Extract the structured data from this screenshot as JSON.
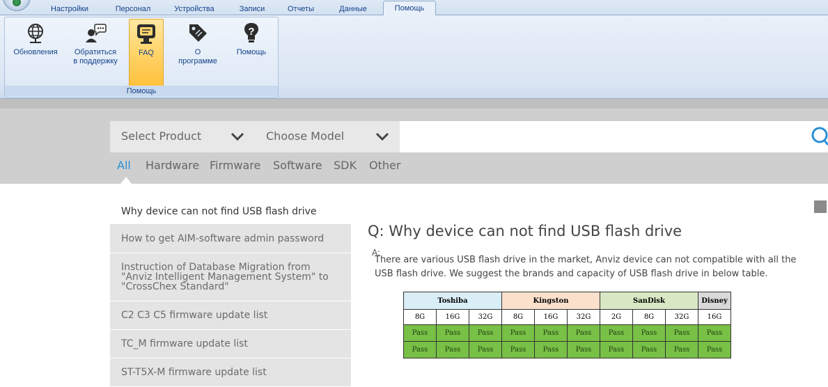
{
  "ribbon": {
    "tabs": [
      {
        "label": "Настройки"
      },
      {
        "label": "Персонал"
      },
      {
        "label": "Устройства"
      },
      {
        "label": "Записи"
      },
      {
        "label": "Отчеты"
      },
      {
        "label": "Данные"
      },
      {
        "label": "Помощь",
        "active": true
      }
    ],
    "group_caption": "Помощь",
    "buttons": [
      {
        "label": "Обновления",
        "icon": "globe-icon"
      },
      {
        "label": "Обратиться\nв поддержку",
        "icon": "user-support-icon"
      },
      {
        "label": "FAQ",
        "icon": "faq-monitor-icon",
        "selected": true
      },
      {
        "label": "О\nпрограмме",
        "icon": "tag-icon"
      },
      {
        "label": "Помощь",
        "icon": "help-question-icon"
      }
    ]
  },
  "filters": {
    "product_placeholder": "Select Product",
    "model_placeholder": "Choose Model"
  },
  "categories": [
    "All",
    "Hardware",
    "Firmware",
    "Software",
    "SDK",
    "Other"
  ],
  "questions": [
    "Why device can not find USB flash drive",
    "How to get AIM-software admin password",
    "Instruction of Database Migration from \"Anviz Intelligent Management System\" to \"CrossChex Standard\"",
    "C2 C3 C5 firmware update list",
    "TC_M firmware update list",
    "ST-T5X-M firmware update list"
  ],
  "answer": {
    "q_prefix": "Q:",
    "title": "Why device can not find USB flash drive",
    "a_prefix": "A:",
    "text": "There are various USB flash drive in the market, Anviz device can not compatible with all the USB flash drive. We suggest the brands and capacity of USB flash drive in below table."
  },
  "usb_table": {
    "brands": [
      {
        "name": "Toshiba",
        "color": "#d9eef7",
        "caps": [
          "8G",
          "16G",
          "32G"
        ]
      },
      {
        "name": "Kingston",
        "color": "#fbe0cc",
        "caps": [
          "8G",
          "16G",
          "32G"
        ]
      },
      {
        "name": "SanDisk",
        "color": "#d8e8c4",
        "caps": [
          "2G",
          "8G",
          "32G"
        ]
      },
      {
        "name": "Disney",
        "color": "#d9d9d9",
        "caps": [
          "16G"
        ]
      }
    ],
    "rows": [
      [
        "Pass",
        "Pass",
        "Pass",
        "Pass",
        "Pass",
        "Pass",
        "Pass",
        "Pass",
        "Pass",
        "Pass"
      ],
      [
        "Pass",
        "Pass",
        "Pass",
        "Pass",
        "Pass",
        "Pass",
        "Pass",
        "Pass",
        "Pass",
        "Pass"
      ]
    ]
  }
}
